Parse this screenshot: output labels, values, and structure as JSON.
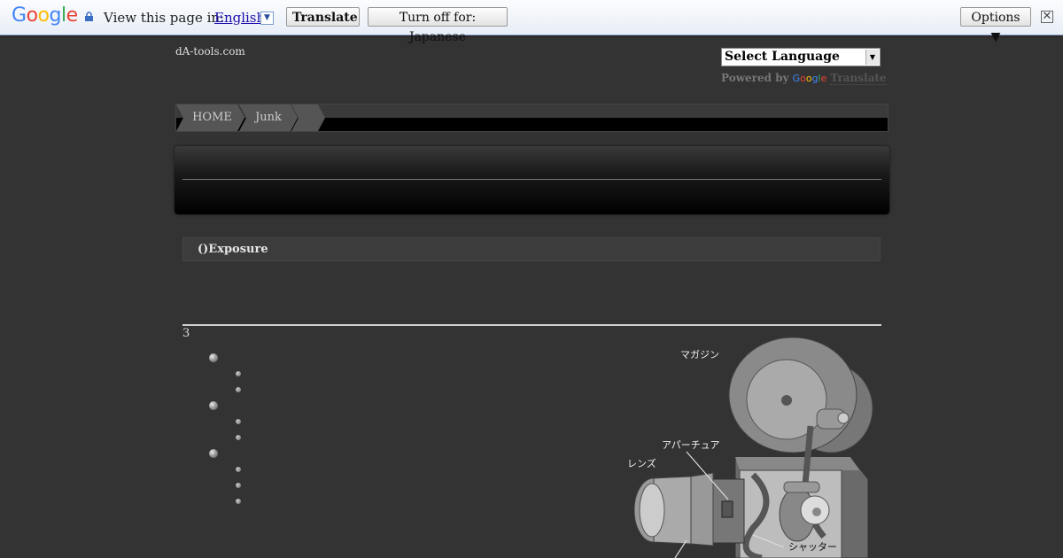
{
  "translate_bar": {
    "logo": "Google",
    "view_text": "View this page in:",
    "language": "English",
    "translate_button": "Translate",
    "turn_off_button": "Turn off for: Japanese",
    "options_button": "Options ▼",
    "close": "✕"
  },
  "header": {
    "site_name": "dA-tools.com",
    "language_select": "Select Language",
    "powered_by": "Powered by",
    "powered_google": "Google",
    "powered_translate": "Translate"
  },
  "breadcrumb": [
    "HOME",
    "Junk",
    ""
  ],
  "section_title": "()Exposure",
  "list_number": "3",
  "diagram_labels": {
    "magazine": "マガジン",
    "aperture": "アパーチュア",
    "lens": "レンズ",
    "shutter": "シャッター"
  }
}
